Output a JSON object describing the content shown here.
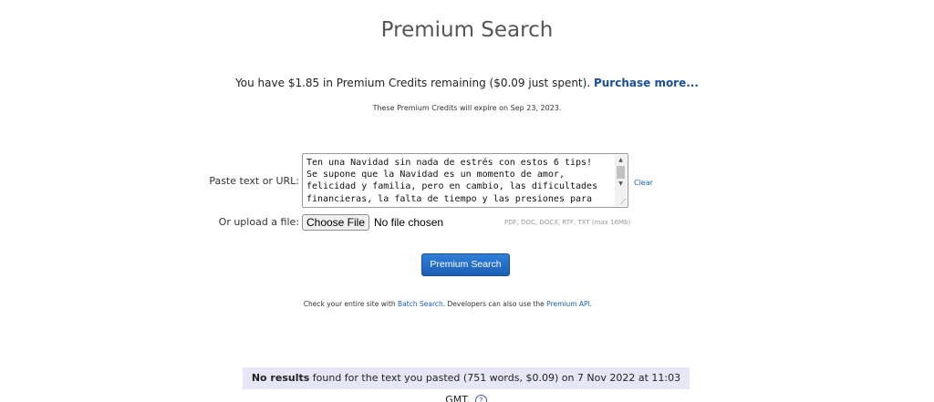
{
  "header": {
    "title": "Premium Search"
  },
  "credits": {
    "text": "You have $1.85 in Premium Credits remaining ($0.09 just spent).",
    "purchase_link": "Purchase more...",
    "expire_text": "These Premium Credits will expire on Sep 23, 2023."
  },
  "form": {
    "paste_label": "Paste text or URL:",
    "paste_value": "Ten una Navidad sin nada de estrés con estos 6 tips!\nSe supone que la Navidad es un momento de amor,\nfelicidad y familia, pero en cambio, las dificultades\nfinancieras, la falta de tiempo y las presiones para",
    "clear_link": "Clear",
    "upload_label": "Or upload a file:",
    "choose_file_label": "Choose File",
    "no_file_text": "No file chosen",
    "formats_text": "PDF, DOC, DOCX, RTF, TXT (max 16Mb)",
    "search_button": "Premium Search"
  },
  "footer": {
    "batch_prefix": "Check your entire site with ",
    "batch_link": "Batch Search",
    "batch_middle": ". Developers can also use the ",
    "api_link": "Premium API",
    "batch_suffix": "."
  },
  "result": {
    "bold_text": "No results",
    "text": " found for the text you pasted (751 words, $0.09) on 7 Nov 2022 at 11:03 GMT.",
    "help_icon": "question-circle-icon"
  },
  "colors": {
    "link": "#1a5fb4",
    "button": "#1b5fb8",
    "result_bg": "#e6e6f7"
  }
}
